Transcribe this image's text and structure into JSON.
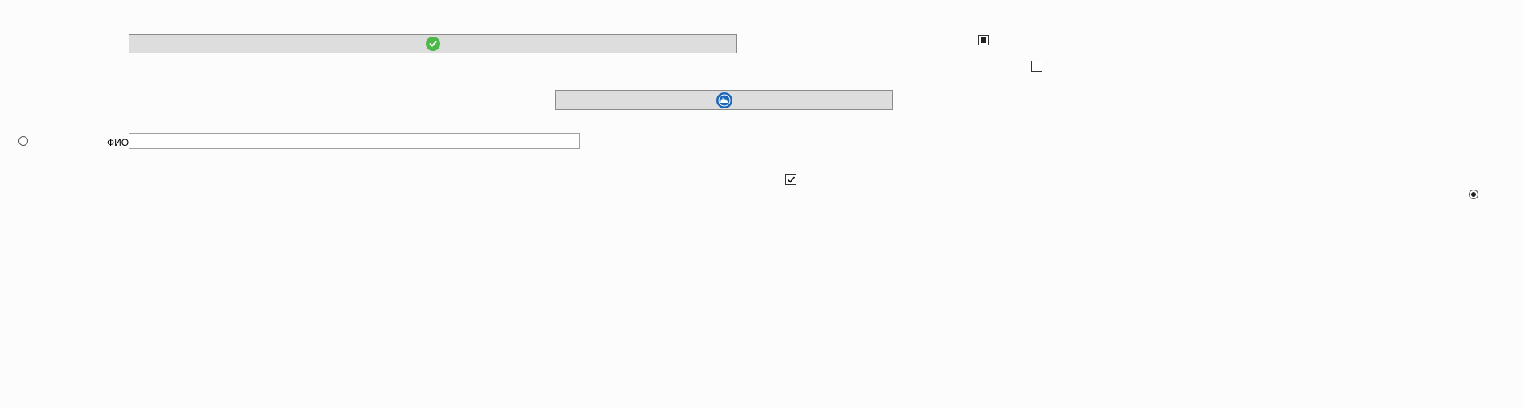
{
  "form": {
    "submit_icon": "check-circle-icon",
    "globe_icon": "globe-icon",
    "fio_label": "ФИО",
    "fio_value": "",
    "fio_placeholder": "",
    "checkbox_top": "indeterminate",
    "checkbox_middle": "unchecked",
    "checkbox_lower": "checked",
    "radio_left": "unselected",
    "radio_right": "selected"
  },
  "colors": {
    "button_bg": "#dddddd",
    "check_icon": "#4cb848",
    "globe_icon": "#1a66b8"
  }
}
